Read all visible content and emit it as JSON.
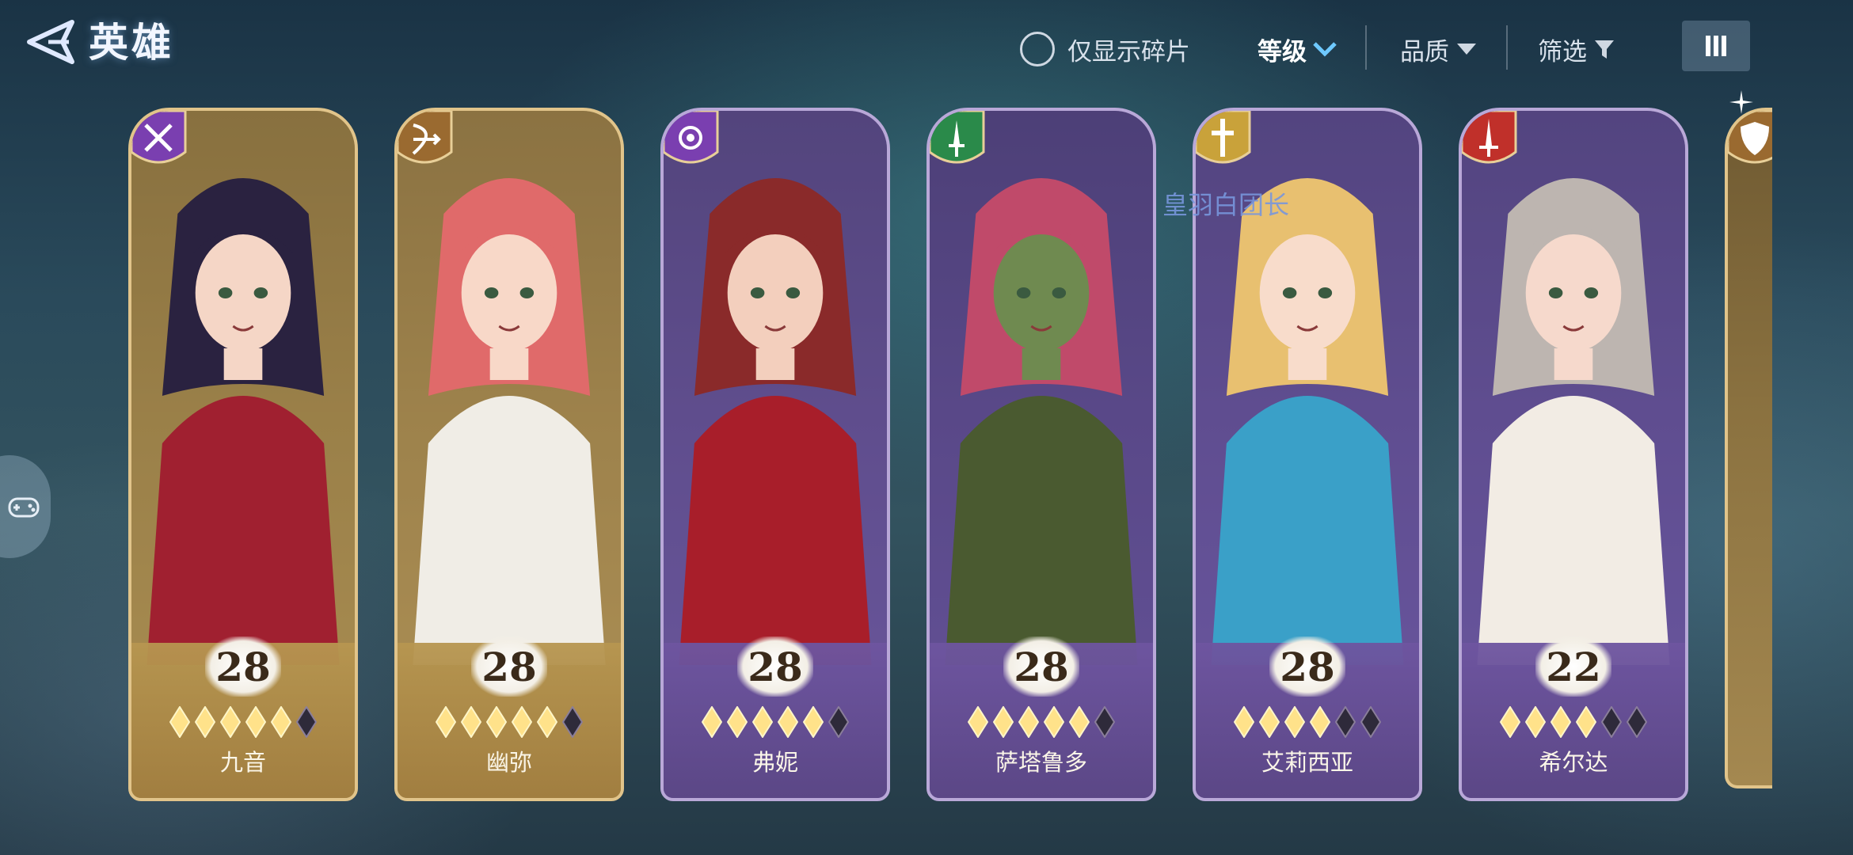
{
  "header": {
    "title": "英雄"
  },
  "filters": {
    "fragment_only_label": "仅显示碎片",
    "level_label": "等级",
    "quality_label": "品质",
    "filter_label": "筛选"
  },
  "overlay_text": "皇羽白团长",
  "heroes": [
    {
      "name": "九音",
      "level": "28",
      "stars": 5,
      "max_stars": 6,
      "rarity": "gold",
      "role_icon": "crossed-swords-icon",
      "role_color": "#7a3fb0"
    },
    {
      "name": "幽弥",
      "level": "28",
      "stars": 5,
      "max_stars": 6,
      "rarity": "gold",
      "role_icon": "bow-icon",
      "role_color": "#9a6a30"
    },
    {
      "name": "弗妮",
      "level": "28",
      "stars": 5,
      "max_stars": 6,
      "rarity": "purple",
      "role_icon": "magic-orb-icon",
      "role_color": "#7a3fb0"
    },
    {
      "name": "萨塔鲁多",
      "level": "28",
      "stars": 5,
      "max_stars": 6,
      "rarity": "purple",
      "role_icon": "dagger-icon",
      "role_color": "#2a8a4a"
    },
    {
      "name": "艾莉西亚",
      "level": "28",
      "stars": 4,
      "max_stars": 6,
      "rarity": "purple",
      "role_icon": "holy-cross-icon",
      "role_color": "#c9a23a"
    },
    {
      "name": "希尔达",
      "level": "22",
      "stars": 4,
      "max_stars": 6,
      "rarity": "purple",
      "role_icon": "flame-sword-icon",
      "role_color": "#c0302a"
    }
  ],
  "partial_hero": {
    "role_icon": "shield-icon",
    "role_color": "#9a6a30"
  }
}
